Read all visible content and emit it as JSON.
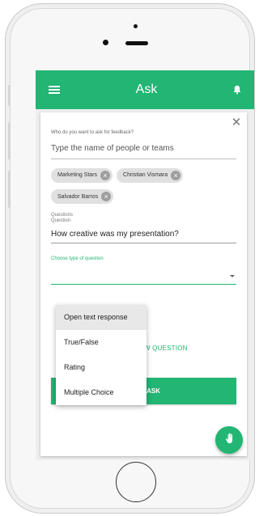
{
  "app_bar": {
    "title": "Ask",
    "menu_icon": "hamburger-menu-icon",
    "notification_icon": "bell-icon",
    "color": "#22b573"
  },
  "form": {
    "who_label": "Who do you want to ask for feedback?",
    "people_placeholder": "Type the name of people or teams",
    "recipients": [
      {
        "label": "Marketing Stars"
      },
      {
        "label": "Christian Vismara"
      },
      {
        "label": "Salvador Barros"
      }
    ],
    "questions_heading": "Questions",
    "question_label": "Question",
    "question_value": "How creative was my presentation?",
    "type_label": "Choose type of question",
    "add_question_label": "W QUESTION",
    "send_label": "SEND ASK"
  },
  "type_dropdown": {
    "options": [
      "Open text response",
      "True/False",
      "Rating",
      "Multiple Choice"
    ],
    "highlighted": "Open text response"
  },
  "fab": {
    "icon": "hand-icon"
  }
}
